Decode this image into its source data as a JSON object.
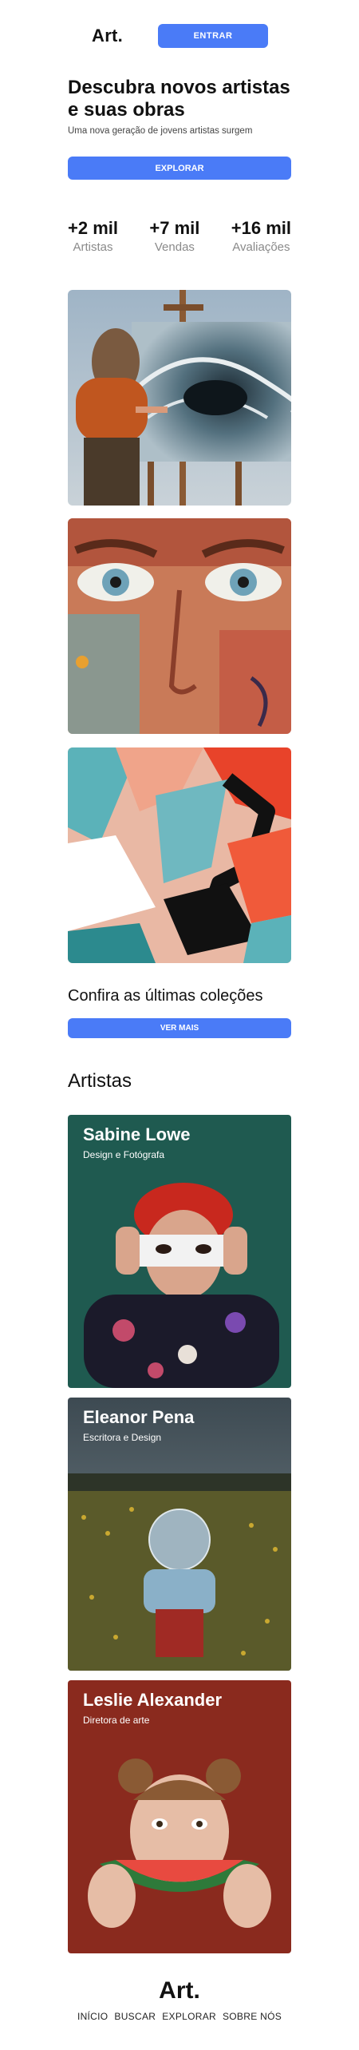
{
  "header": {
    "logo": "Art.",
    "enter_label": "ENTRAR"
  },
  "hero": {
    "title": "Descubra novos artistas e suas obras",
    "subtitle": "Uma nova geração de jovens artistas surgem",
    "explore_label": "EXPLORAR"
  },
  "stats": [
    {
      "value": "+2 mil",
      "label": "Artistas"
    },
    {
      "value": "+7 mil",
      "label": "Vendas"
    },
    {
      "value": "+16 mil",
      "label": "Avaliações"
    }
  ],
  "collections": {
    "heading": "Confira as últimas coleções",
    "more_label": "VER MAIS"
  },
  "artists": {
    "heading": "Artistas",
    "items": [
      {
        "name": "Sabine Lowe",
        "role": "Design e Fotógrafa"
      },
      {
        "name": "Eleanor Pena",
        "role": "Escritora e Design"
      },
      {
        "name": "Leslie Alexander",
        "role": "Diretora de arte"
      }
    ]
  },
  "footer": {
    "logo": "Art.",
    "nav": [
      "INÍCIO",
      "BUSCAR",
      "EXPLORAR",
      "SOBRE NÓS"
    ]
  }
}
